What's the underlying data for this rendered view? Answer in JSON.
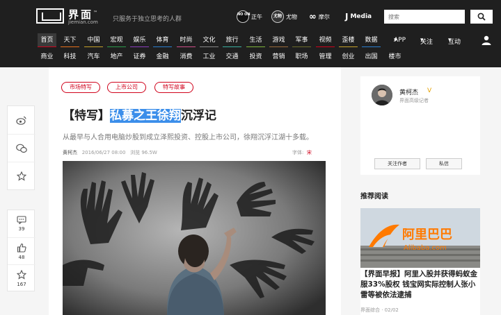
{
  "header": {
    "logo_text": "界面",
    "logo_tm": "™",
    "logo_domain": "jiemian.com",
    "slogan": "只服务于独立思考的人群",
    "partners": [
      {
        "badge": "NO ON",
        "label": "正午"
      },
      {
        "badge": "尤物",
        "label": "尤物"
      },
      {
        "badge": "∞",
        "label": "摩尔"
      },
      {
        "badge": "J",
        "label": "Media"
      }
    ],
    "search_placeholder": "搜索"
  },
  "nav_row1": [
    "首页",
    "天下",
    "中国",
    "宏观",
    "娱乐",
    "体育",
    "时尚",
    "文化",
    "旅行",
    "生活",
    "游戏",
    "军事",
    "视频",
    "歪楼",
    "数据"
  ],
  "nav_row2": [
    "商业",
    "科技",
    "汽车",
    "地产",
    "证券",
    "金融",
    "消费",
    "工业",
    "交通",
    "投资",
    "营销",
    "职场",
    "管理",
    "创业",
    "出国",
    "楼市"
  ],
  "right_nav": [
    "APP",
    "关注",
    "互动"
  ],
  "left_rail": {
    "comments": "39",
    "likes": "48",
    "favorites": "167"
  },
  "article": {
    "tags": [
      "市场特写",
      "上市公司",
      "特写故事"
    ],
    "title_prefix": "【特写】",
    "title_highlight": "私募之王徐翔",
    "title_suffix": "沉浮记",
    "summary": "从最早与人合用电脑炒股到成立泽熙投资、控股上市公司，徐翔沉浮江湖十多载。",
    "author": "黄柯杰",
    "date": "2016/06/27 08:00",
    "views": "浏览 96.5W",
    "font_label": "字体:",
    "font_size": "宋"
  },
  "author_card": {
    "name": "黄柯杰",
    "verified": "V",
    "role": "界面高级记者",
    "follow_label": "关注作者",
    "message_label": "私信"
  },
  "recommend": {
    "heading": "推荐阅读",
    "title": "【界面早报】阿里入股并获得蚂蚁金服33%股权 钱宝网实际控制人张小雷等被依法逮捕",
    "source": "界面综合",
    "date": "· 02/02",
    "img_text_cn": "阿里巴巴",
    "img_text_en": "Alibaba.com"
  }
}
